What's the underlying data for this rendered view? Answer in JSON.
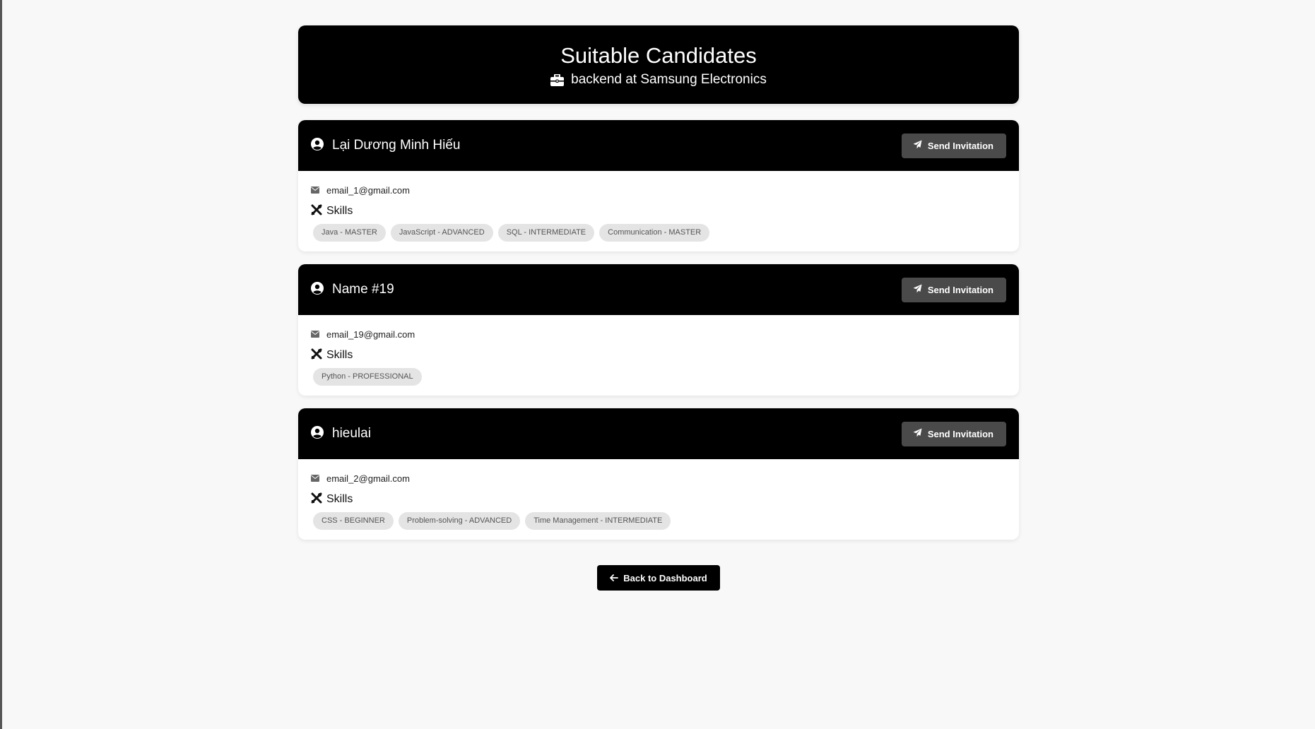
{
  "header": {
    "title": "Suitable Candidates",
    "subtitle": "backend at Samsung Electronics",
    "icon": "briefcase-icon"
  },
  "candidates": [
    {
      "name": "Lại Dương Minh Hiếu",
      "email": "email_1@gmail.com",
      "skills_label": "Skills",
      "invite_label": "Send Invitation",
      "skills": [
        "Java - MASTER",
        "JavaScript - ADVANCED",
        "SQL - INTERMEDIATE",
        "Communication - MASTER"
      ]
    },
    {
      "name": "Name #19",
      "email": "email_19@gmail.com",
      "skills_label": "Skills",
      "invite_label": "Send Invitation",
      "skills": [
        "Python - PROFESSIONAL"
      ]
    },
    {
      "name": "hieulai",
      "email": "email_2@gmail.com",
      "skills_label": "Skills",
      "invite_label": "Send Invitation",
      "skills": [
        "CSS - BEGINNER",
        "Problem-solving - ADVANCED",
        "Time Management - INTERMEDIATE"
      ]
    }
  ],
  "footer": {
    "back_label": "Back to Dashboard",
    "back_icon": "arrow-left-icon"
  },
  "colors": {
    "background": "#f8f8f8",
    "header_bg": "#000000",
    "button_gray": "#4a4a4a",
    "chip_bg": "#e4e4e4"
  }
}
